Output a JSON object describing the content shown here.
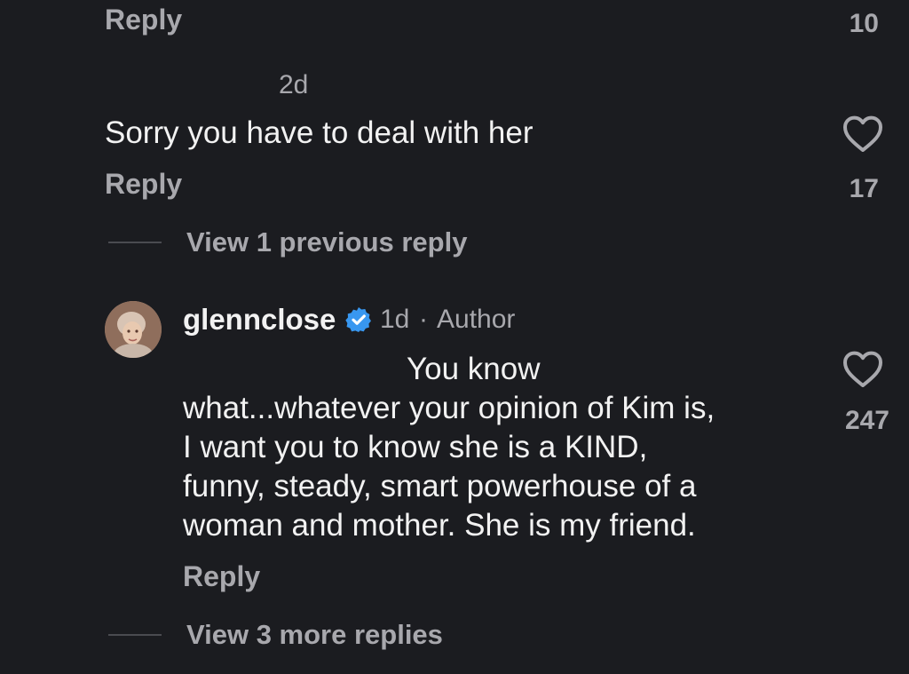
{
  "comment1": {
    "reply_label": "Reply",
    "like_count": "10"
  },
  "comment2": {
    "time": "2d",
    "text": "Sorry you have to deal with her",
    "reply_label": "Reply",
    "like_count": "17"
  },
  "thread1": {
    "view_replies": "View 1 previous reply"
  },
  "comment3": {
    "username": "glennclose",
    "time": "1d",
    "separator": "·",
    "author_label": "Author",
    "text_line1": "You know",
    "text_line2": "what...whatever your opinion of Kim is,",
    "text_line3": "I want you to know she is a KIND,",
    "text_line4": "funny, steady, smart powerhouse of a",
    "text_line5": "woman and mother. She is my friend.",
    "reply_label": "Reply",
    "like_count": "247"
  },
  "thread2": {
    "view_replies": "View 3 more replies"
  },
  "icons": {
    "heart": "heart-outline-icon",
    "verified": "verified-badge-icon"
  },
  "colors": {
    "background": "#1b1c20",
    "text": "#f2f2f2",
    "muted": "#a8a8ad",
    "verified": "#3897f0"
  }
}
